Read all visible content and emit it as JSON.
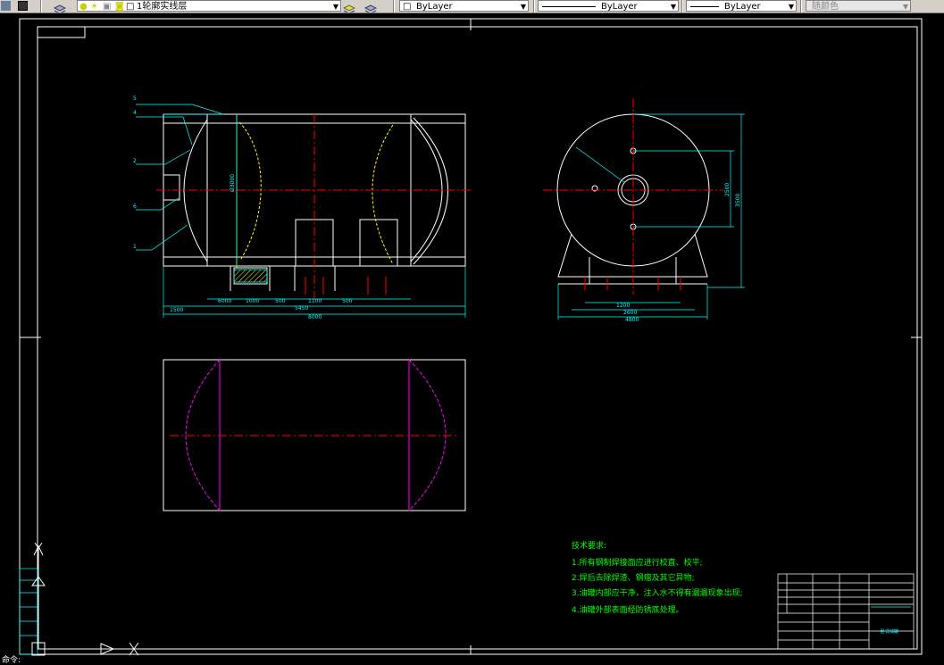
{
  "toolbar": {
    "layer_name": "1轮廓实线层",
    "color": "ByLayer",
    "linetype": "ByLayer",
    "lineweight": "ByLayer",
    "plot_style": "随颜色"
  },
  "drawing": {
    "callouts": [
      "5",
      "4",
      "2",
      "6",
      "1"
    ],
    "dims_front_bottom": [
      "1500",
      "6000",
      "1000",
      "500",
      "1100",
      "500"
    ],
    "dim_front_mid": "5450",
    "dim_front_total": "8000",
    "dim_front_height": "Ø3000",
    "dims_side_bottom": [
      "1200",
      "2600",
      "4800"
    ],
    "dims_side_right": [
      "2500",
      "3500"
    ],
    "tech_title": "技术要求:",
    "tech_notes": [
      "1.所有钢制焊接面应进行校直、校平;",
      "2.焊后去除焊渣、钢瘤及其它异物;",
      "3.油罐内部应干净，注入水不得有漏漏现象出现;",
      "4.油罐外部表面经防锈底处理。"
    ],
    "title_block_name": "卧式油罐"
  },
  "status": {
    "command_text": "命令:"
  },
  "colors": {
    "background": "#000000",
    "frame": "#ffffff",
    "centerline": "#ff0000",
    "dimension": "#00ffff",
    "hidden_curve": "#ffff00",
    "phantom": "#ff00ff",
    "note_text": "#00ff00"
  }
}
